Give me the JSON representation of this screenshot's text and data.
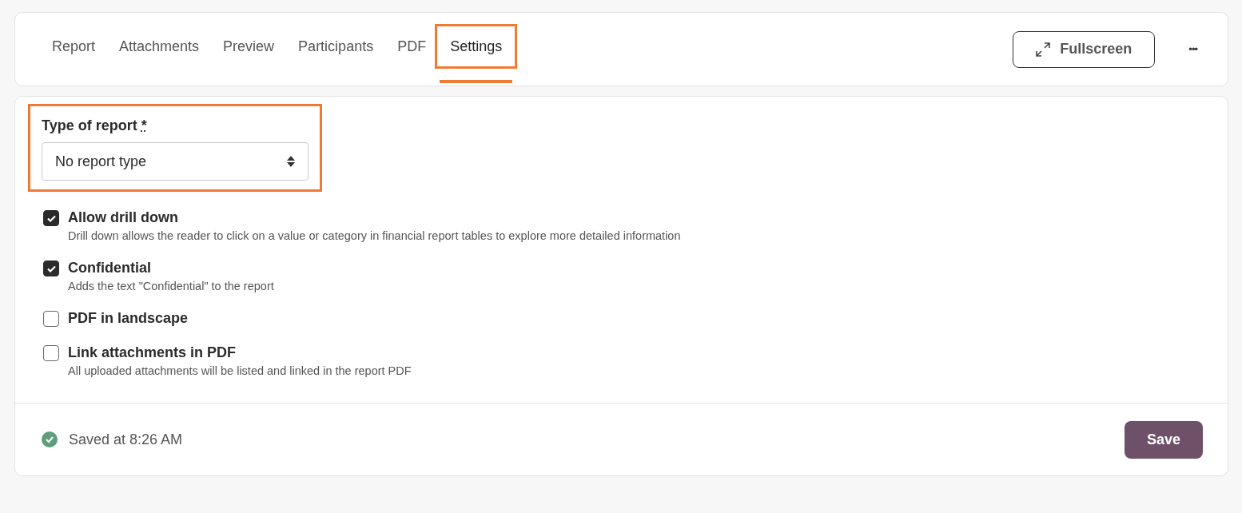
{
  "tabs": [
    {
      "label": "Report",
      "selected": false,
      "highlighted": false
    },
    {
      "label": "Attachments",
      "selected": false,
      "highlighted": false
    },
    {
      "label": "Preview",
      "selected": false,
      "highlighted": false
    },
    {
      "label": "Participants",
      "selected": false,
      "highlighted": false
    },
    {
      "label": "PDF",
      "selected": false,
      "highlighted": false
    },
    {
      "label": "Settings",
      "selected": true,
      "highlighted": true
    }
  ],
  "fullscreen_button": {
    "label": "Fullscreen"
  },
  "more_button": {
    "label": "•••"
  },
  "report_type": {
    "label": "Type of report",
    "required_mark": "*",
    "value": "No report type",
    "highlighted": true
  },
  "options": [
    {
      "title": "Allow drill down",
      "description": "Drill down allows the reader to click on a value or category in financial report tables to explore more detailed information",
      "checked": true
    },
    {
      "title": "Confidential",
      "description": "Adds the text \"Confidential\" to the report",
      "checked": true
    },
    {
      "title": "PDF in landscape",
      "checked": false
    },
    {
      "title": "Link attachments in PDF",
      "description": "All uploaded attachments will be listed and linked in the report PDF",
      "checked": false
    }
  ],
  "footer": {
    "status": "Saved at 8:26 AM",
    "save_button": "Save"
  }
}
